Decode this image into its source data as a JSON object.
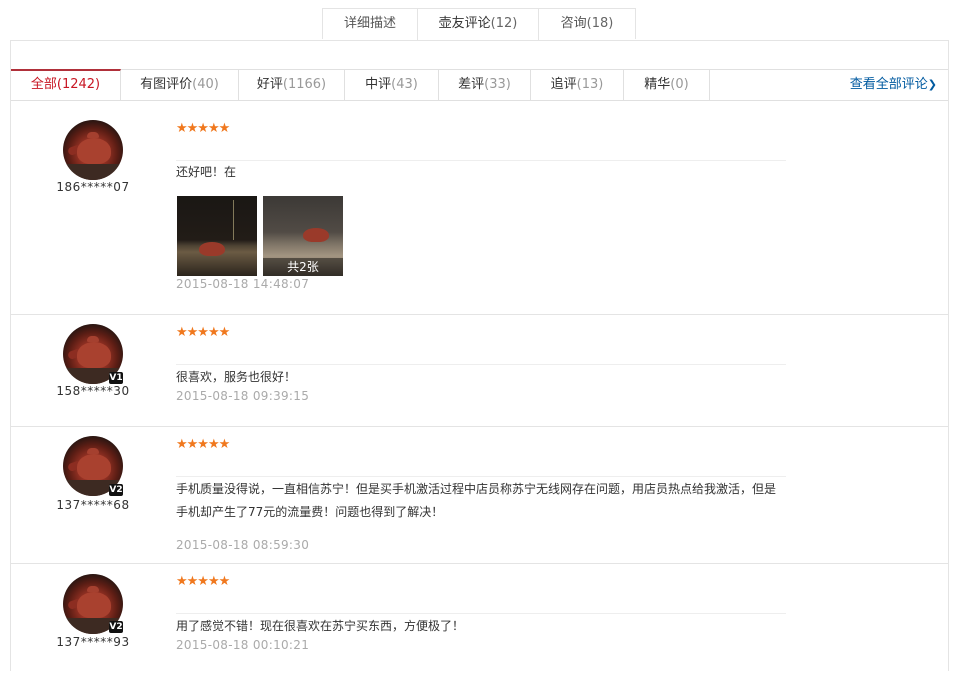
{
  "top_tabs": [
    {
      "label": "详细描述",
      "count": ""
    },
    {
      "label": "壶友评论",
      "count": "(12)"
    },
    {
      "label": "咨询",
      "count": "(18)"
    }
  ],
  "filters": [
    {
      "label": "全部",
      "count": "(1242)"
    },
    {
      "label": "有图评价",
      "count": "(40)"
    },
    {
      "label": "好评",
      "count": "(1166)"
    },
    {
      "label": "中评",
      "count": "(43)"
    },
    {
      "label": "差评",
      "count": "(33)"
    },
    {
      "label": "追评",
      "count": "(13)"
    },
    {
      "label": "精华",
      "count": "(0)"
    }
  ],
  "view_all": "查看全部评论",
  "reviews": [
    {
      "user": "186*****07",
      "level": "",
      "stars": "★★★★★",
      "text": "还好吧！在",
      "photos_count_label": "共2张",
      "date": "2015-08-18 14:48:07"
    },
    {
      "user": "158*****30",
      "level": "V1",
      "stars": "★★★★★",
      "text": "很喜欢，服务也很好！",
      "date": "2015-08-18 09:39:15"
    },
    {
      "user": "137*****68",
      "level": "V2",
      "stars": "★★★★★",
      "text": "手机质量没得说，一直相信苏宁！但是买手机激活过程中店员称苏宁无线网存在问题，用店员热点给我激活，但是手机却产生了77元的流量费！问题也得到了解决！",
      "date": "2015-08-18 08:59:30"
    },
    {
      "user": "137*****93",
      "level": "V2",
      "stars": "★★★★★",
      "text": "用了感觉不错！现在很喜欢在苏宁买东西，方便极了！",
      "date": "2015-08-18 00:10:21"
    }
  ],
  "colors": {
    "accent": "#c81623",
    "star": "#f0781e",
    "link": "#005aa0"
  }
}
